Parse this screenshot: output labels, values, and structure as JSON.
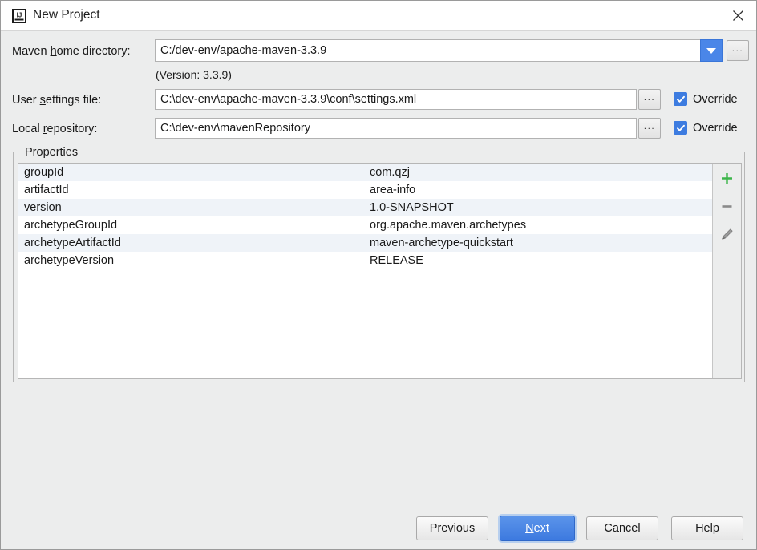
{
  "window": {
    "title": "New Project",
    "app_icon": "intellij-idea-icon",
    "close_icon": "close-icon"
  },
  "form": {
    "maven_home": {
      "label_before": "Maven ",
      "label_mnemonic": "h",
      "label_after": "ome directory:",
      "value": "C:/dev-env/apache-maven-3.3.9",
      "dropdown_icon": "chevron-down-icon",
      "browse_label": "...",
      "version_note": "(Version: 3.3.9)"
    },
    "user_settings": {
      "label_before": "User ",
      "label_mnemonic": "s",
      "label_after": "ettings file:",
      "value": "C:\\dev-env\\apache-maven-3.3.9\\conf\\settings.xml",
      "browse_label": "...",
      "override_label": "Override",
      "override_checked": true,
      "check_icon": "check-icon"
    },
    "local_repository": {
      "label_before": "Local ",
      "label_mnemonic": "r",
      "label_after": "epository:",
      "value": "C:\\dev-env\\mavenRepository",
      "browse_label": "...",
      "override_label": "Override",
      "override_checked": true,
      "check_icon": "check-icon"
    }
  },
  "properties": {
    "legend": "Properties",
    "rows": [
      {
        "key": "groupId",
        "value": "com.qzj"
      },
      {
        "key": "artifactId",
        "value": "area-info"
      },
      {
        "key": "version",
        "value": "1.0-SNAPSHOT"
      },
      {
        "key": "archetypeGroupId",
        "value": "org.apache.maven.archetypes"
      },
      {
        "key": "archetypeArtifactId",
        "value": "maven-archetype-quickstart"
      },
      {
        "key": "archetypeVersion",
        "value": "RELEASE"
      }
    ],
    "toolbar": {
      "add_icon": "plus-icon",
      "remove_icon": "minus-icon",
      "edit_icon": "pencil-icon"
    }
  },
  "footer": {
    "previous": "Previous",
    "next_before": "",
    "next_mnemonic": "N",
    "next_after": "ext",
    "cancel": "Cancel",
    "help": "Help"
  },
  "colors": {
    "accent_blue": "#3d7ce0",
    "primary_button": "#4a86e8",
    "dialog_bg": "#eceded",
    "row_alt": "#eff3f8",
    "add_green": "#3cb54a",
    "remove_gray": "#8a8a8a"
  }
}
